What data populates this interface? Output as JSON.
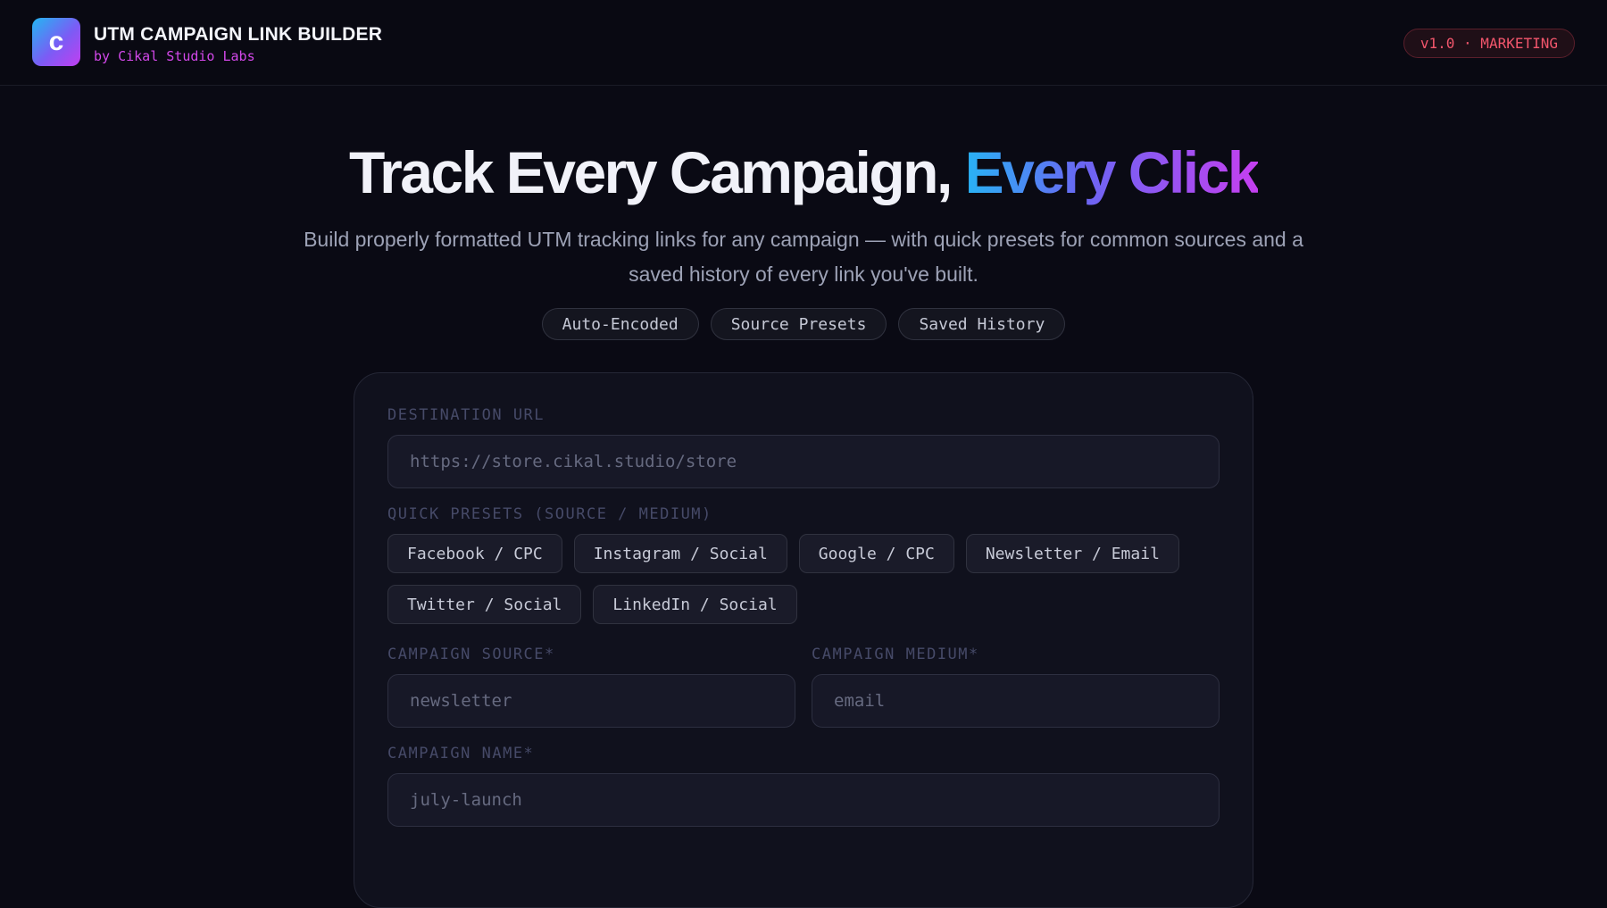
{
  "header": {
    "logo_letter": "c",
    "title": "UTM CAMPAIGN LINK BUILDER",
    "subtitle": "by Cikal Studio Labs",
    "version_badge": "v1.0 · MARKETING"
  },
  "hero": {
    "title_plain": "Track Every Campaign, ",
    "title_accent": "Every Click",
    "description": "Build properly formatted UTM tracking links for any campaign — with quick presets for common sources and a saved history of every link you've built.",
    "features": [
      "Auto-Encoded",
      "Source Presets",
      "Saved History"
    ]
  },
  "form": {
    "destination_label": "DESTINATION URL",
    "destination_placeholder": "https://store.cikal.studio/store",
    "presets_label": "QUICK PRESETS (SOURCE / MEDIUM)",
    "presets": [
      "Facebook / CPC",
      "Instagram / Social",
      "Google / CPC",
      "Newsletter / Email",
      "Twitter / Social",
      "LinkedIn / Social"
    ],
    "source_label": "CAMPAIGN SOURCE*",
    "source_placeholder": "newsletter",
    "medium_label": "CAMPAIGN MEDIUM*",
    "medium_placeholder": "email",
    "name_label": "CAMPAIGN NAME*",
    "name_placeholder": "july-launch"
  },
  "colors": {
    "background": "#0a0a14",
    "card": "#10111d",
    "accent_gradient_start": "#28b3f5",
    "accent_gradient_end": "#c53ff0",
    "badge_red": "#f2566c",
    "subtitle_magenta": "#d348ea"
  }
}
